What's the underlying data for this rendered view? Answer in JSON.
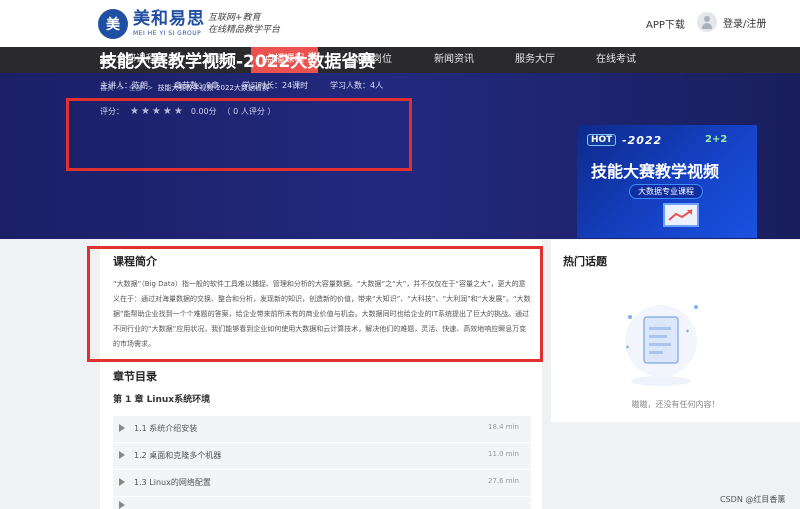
{
  "header": {
    "logo_mark": "美",
    "logo_name": "美和易思",
    "logo_sub": "MEI HE YI SI GROUP",
    "slogan_line1": "互联网+教育",
    "slogan_line2": "在线精品教学平台",
    "app_download": "APP下载",
    "login": "登录/注册"
  },
  "nav": {
    "all_courses": "全部课程",
    "items": [
      "首页",
      "点播课程",
      "就业岗位",
      "新闻资讯",
      "服务大厅",
      "在线考试"
    ],
    "active_index": 1
  },
  "breadcrumb": {
    "home": "首页",
    "sep": ">",
    "all": "全部",
    "current": "技能大赛教学视频-2022大数据省赛"
  },
  "course": {
    "title": "技能大赛教学视频-2022大数据省赛",
    "lecturer": "主讲人：陈朗",
    "chapters": "章节数：9章",
    "duration": "学习时长：24课时",
    "learners": "学习人数：4人",
    "rating_label": "评分：",
    "stars": "★★★★★",
    "rating_value": "0.00分",
    "rating_count": "（ 0 人评分 ）"
  },
  "promo": {
    "hot": "HOT",
    "year": "-2022",
    "plus": "2+2",
    "title": "技能大赛教学视频",
    "tag": "大数据专业课程"
  },
  "intro": {
    "heading": "课程简介",
    "text": "“大数据”（Big Data）指一般的软件工具难以捕捉、管理和分析的大容量数据。“大数据”之“大”，并不仅仅在于“容量之大”，更大的意义在于：通过对海量数据的交换、整合和分析，发现新的知识，创造新的价值，带来“大知识”、“大科技”、“大利润”和“大发展”。“大数据”能帮助企业找到一个个难题的答案，给企业带来前所未有的商业价值与机会。大数据同时也给企业的IT系统提出了巨大的挑战。通过不同行业的“大数据”应用状况，我们能够看到企业如何使用大数据和云计算技术，解决他们的难题，灵活、快速、高效地响应瞬息万变的市场需求。"
  },
  "chapters": {
    "heading": "章节目录",
    "chapter1": "第 1 章 Linux系统环境",
    "lessons": [
      {
        "name": "1.1 系统介绍安装",
        "duration": "18.4 min"
      },
      {
        "name": "1.2 桌面和克隆多个机器",
        "duration": "11.0 min"
      },
      {
        "name": "1.3 Linux的网络配置",
        "duration": "27.6 min"
      }
    ]
  },
  "side": {
    "heading": "热门话题",
    "empty": "嗷嗷，还没有任何内容！"
  },
  "watermark": "CSDN @红目香薰"
}
